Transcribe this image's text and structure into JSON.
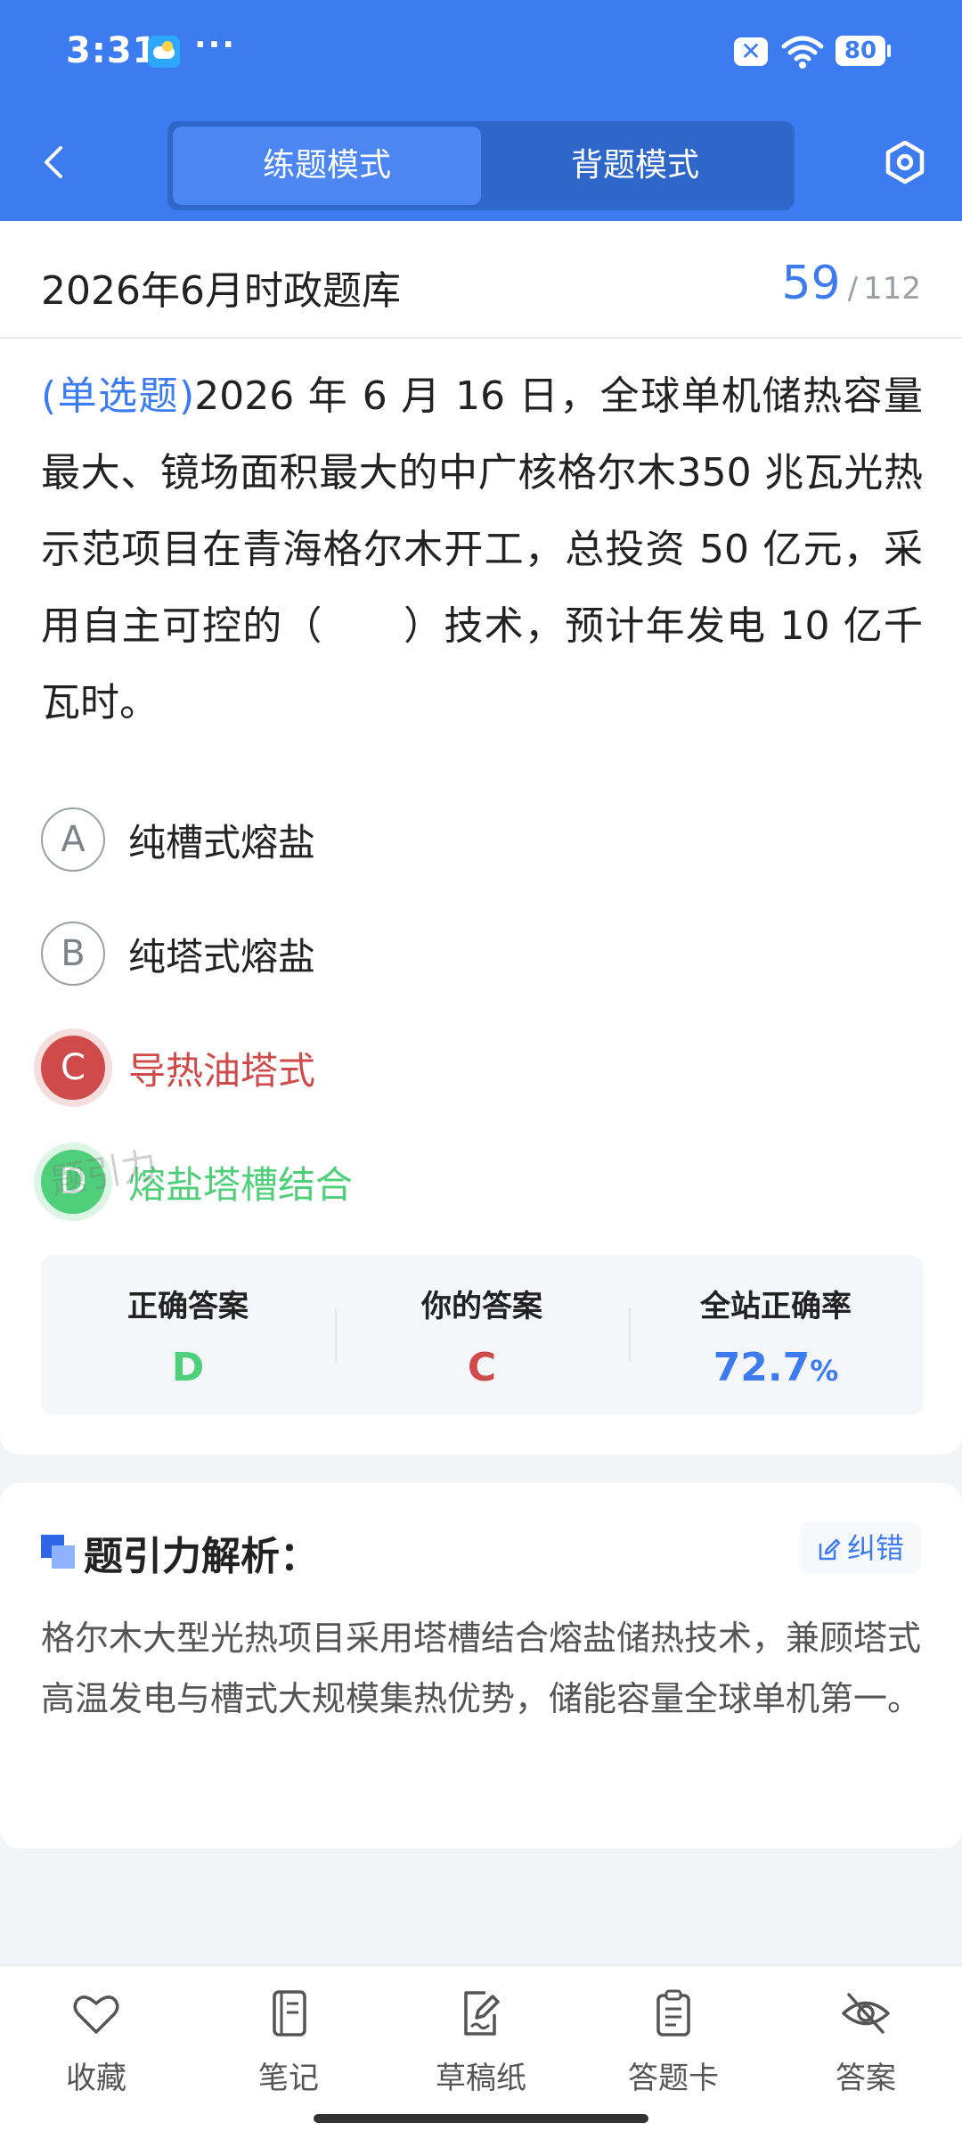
{
  "status_bar": {
    "time": "3:31",
    "more": "···",
    "battery": "80"
  },
  "nav": {
    "tabs": [
      {
        "label": "练题模式"
      },
      {
        "label": "背题模式"
      }
    ]
  },
  "bank": {
    "title": "2026年6月时政题库",
    "current": "59",
    "sep": "/",
    "total": "112"
  },
  "question": {
    "type": "(单选题)",
    "text": "2026 年 6 月 16 日，全球单机储热容量最大、镜场面积最大的中广核格尔木350 兆瓦光热示范项目在青海格尔木开工，总投资 50 亿元，采用自主可控的（　　）技术，预计年发电 10 亿千瓦时。"
  },
  "options": [
    {
      "letter": "A",
      "text": "纯槽式熔盐",
      "state": "normal"
    },
    {
      "letter": "B",
      "text": "纯塔式熔盐",
      "state": "normal"
    },
    {
      "letter": "C",
      "text": "导热油塔式",
      "state": "wrong"
    },
    {
      "letter": "D",
      "text": "熔盐塔槽结合",
      "state": "correct"
    }
  ],
  "watermark": "题引力",
  "result": {
    "correct_label": "正确答案",
    "correct_value": "D",
    "yours_label": "你的答案",
    "yours_value": "C",
    "rate_label": "全站正确率",
    "rate_value": "72.7",
    "rate_unit": "%"
  },
  "analysis": {
    "title": "题引力解析：",
    "correction": "纠错",
    "text": "格尔木大型光热项目采用塔槽结合熔盐储热技术，兼顾塔式高温发电与槽式大规模集热优势，储能容量全球单机第一。"
  },
  "tab_bar": {
    "items": [
      {
        "label": "收藏",
        "icon": "heart-icon"
      },
      {
        "label": "笔记",
        "icon": "notebook-icon"
      },
      {
        "label": "草稿纸",
        "icon": "draft-icon"
      },
      {
        "label": "答题卡",
        "icon": "answer-card-icon"
      },
      {
        "label": "答案",
        "icon": "eye-off-icon"
      }
    ]
  },
  "colors": {
    "primary": "#3c7cf0",
    "wrong": "#cf4a4a",
    "correct": "#4fcf7a"
  }
}
